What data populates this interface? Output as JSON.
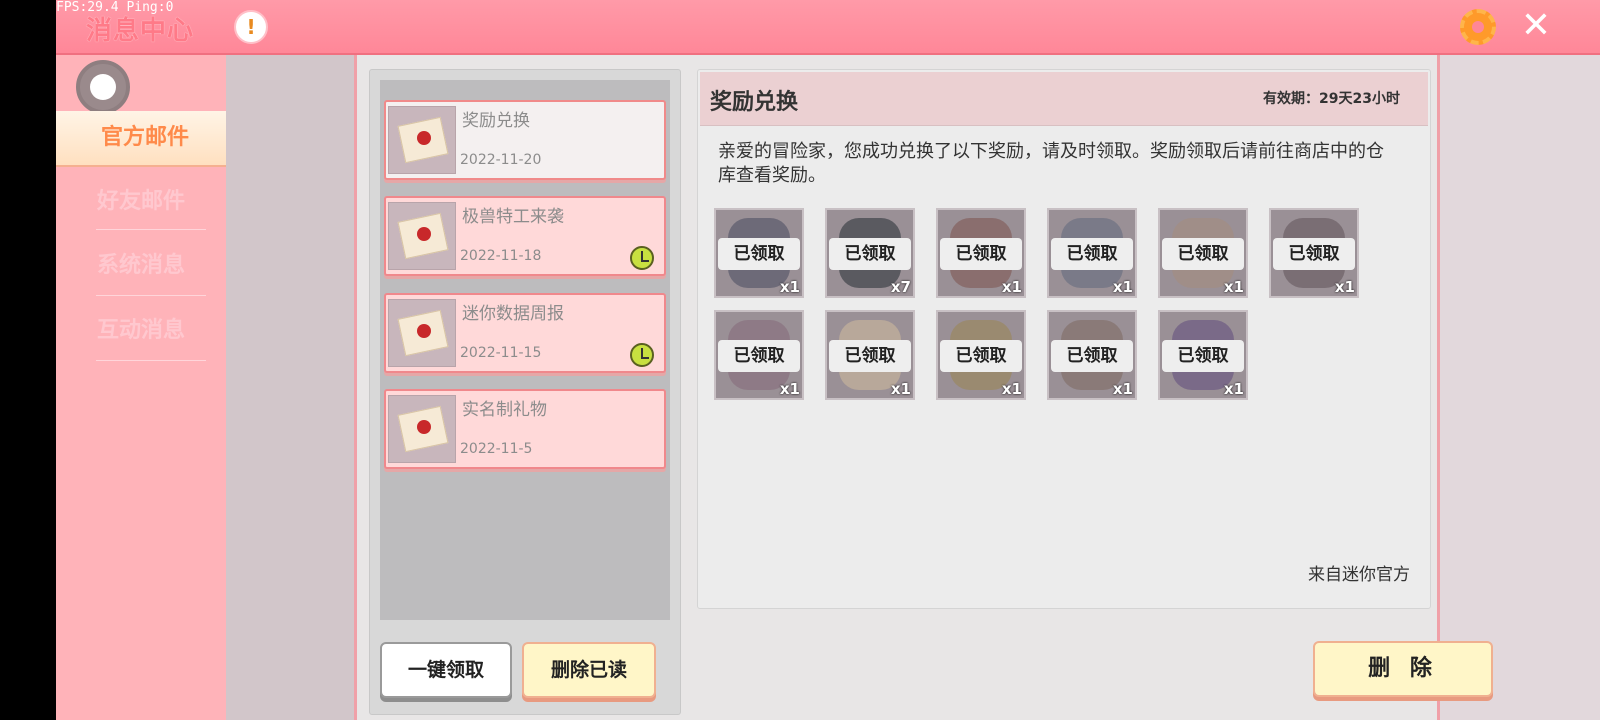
{
  "hud": {
    "fps_text": "FPS:29.4  Ping:0"
  },
  "topbar": {
    "title": "消息中心",
    "info_icon": "exclamation-icon",
    "settings_icon": "gear-icon",
    "close_icon": "close-icon"
  },
  "sidebar": {
    "tabs": [
      {
        "label": "官方邮件",
        "active": true
      },
      {
        "label": "好友邮件",
        "active": false
      },
      {
        "label": "系统消息",
        "active": false
      },
      {
        "label": "互动消息",
        "active": false
      }
    ]
  },
  "mail_list": {
    "items": [
      {
        "title": "奖励兑换",
        "date": "2022-11-20",
        "selected": true,
        "expiring": false
      },
      {
        "title": "极兽特工来袭",
        "date": "2022-11-18",
        "selected": false,
        "expiring": true
      },
      {
        "title": "迷你数据周报",
        "date": "2022-11-15",
        "selected": false,
        "expiring": true
      },
      {
        "title": "实名制礼物",
        "date": "2022-11-5",
        "selected": false,
        "expiring": false
      }
    ],
    "claim_all_label": "一键领取",
    "delete_read_label": "删除已读"
  },
  "detail": {
    "title": "奖励兑换",
    "validity": "有效期：29天23小时",
    "body": "亲爱的冒险家，您成功兑换了以下奖励，请及时领取。奖励领取后请前往商店中的仓库查看奖励。",
    "sender": "来自迷你官方",
    "delete_label": "删 除",
    "rewards": [
      {
        "status": "已领取",
        "qty": "x1"
      },
      {
        "status": "已领取",
        "qty": "x7"
      },
      {
        "status": "已领取",
        "qty": "x1"
      },
      {
        "status": "已领取",
        "qty": "x1"
      },
      {
        "status": "已领取",
        "qty": "x1"
      },
      {
        "status": "已领取",
        "qty": "x1"
      },
      {
        "status": "已领取",
        "qty": "x1"
      },
      {
        "status": "已领取",
        "qty": "x1"
      },
      {
        "status": "已领取",
        "qty": "x1"
      },
      {
        "status": "已领取",
        "qty": "x1"
      },
      {
        "status": "已领取",
        "qty": "x1"
      }
    ]
  },
  "colors": {
    "accent_pink": "#ff8798",
    "sidebar": "#ffb3b9",
    "button_yellow": "#fff6c8"
  }
}
